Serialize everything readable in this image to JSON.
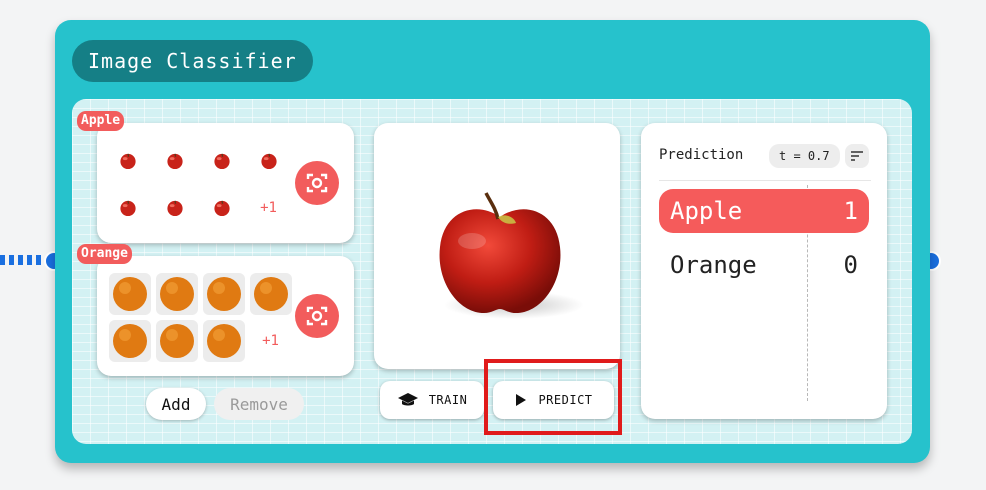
{
  "node": {
    "title": "Image Classifier"
  },
  "classes": [
    {
      "name": "Apple",
      "sample_count_visible": 7,
      "more_label": "+1",
      "icon": "apple-thumbnail"
    },
    {
      "name": "Orange",
      "sample_count_visible": 7,
      "more_label": "+1",
      "icon": "orange-thumbnail"
    }
  ],
  "class_actions": {
    "add_label": "Add",
    "remove_label": "Remove"
  },
  "preview": {
    "icon": "apple-image"
  },
  "actions": {
    "train_label": "TRAIN",
    "predict_label": "PREDICT"
  },
  "prediction": {
    "title": "Prediction",
    "threshold_label": "t = 0.7",
    "rows": [
      {
        "label": "Apple",
        "value": "1"
      },
      {
        "label": "Orange",
        "value": "0"
      }
    ]
  },
  "colors": {
    "accent": "#26c2cc",
    "title_bg": "#157f86",
    "class_tag": "#f25c5c",
    "port": "#1a6fe0",
    "highlight": "#e01b1b"
  }
}
